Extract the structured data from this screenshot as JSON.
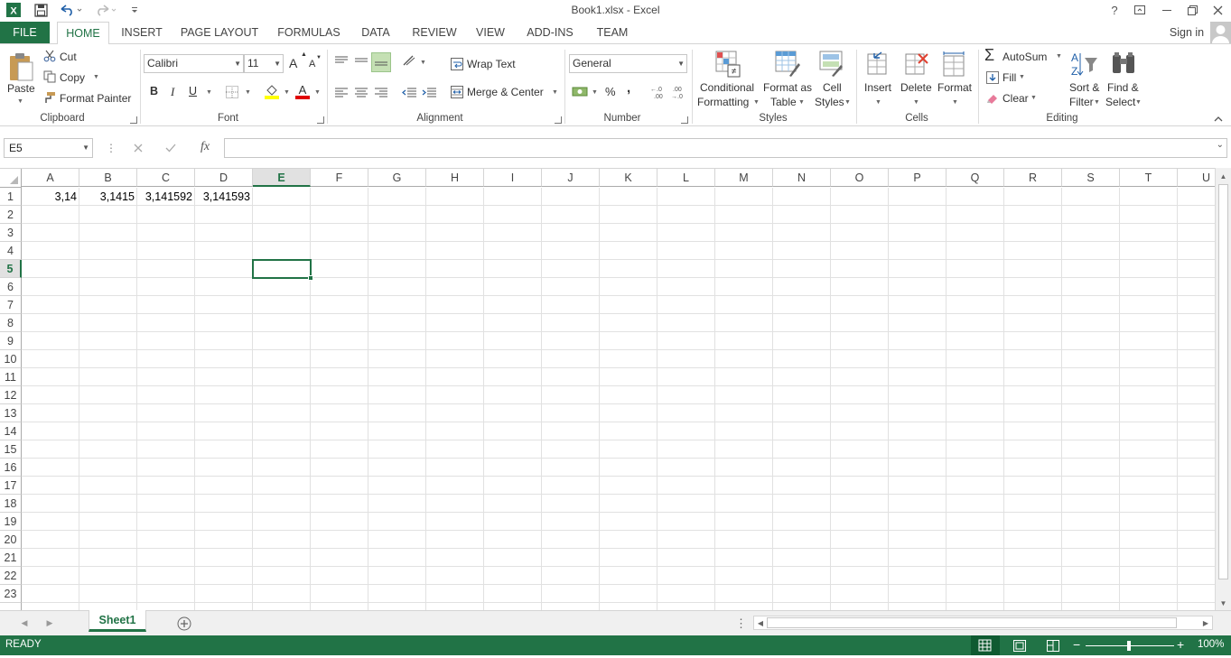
{
  "window": {
    "title": "Book1.xlsx - Excel",
    "sign_in": "Sign in",
    "help": "?"
  },
  "tabs": [
    "FILE",
    "HOME",
    "INSERT",
    "PAGE LAYOUT",
    "FORMULAS",
    "DATA",
    "REVIEW",
    "VIEW",
    "ADD-INS",
    "TEAM"
  ],
  "clipboard": {
    "paste": "Paste",
    "cut": "Cut",
    "copy": "Copy",
    "format_painter": "Format Painter",
    "label": "Clipboard"
  },
  "font": {
    "name": "Calibri",
    "size": "11",
    "bold": "B",
    "italic": "I",
    "underline": "U",
    "grow": "A",
    "shrink": "A",
    "label": "Font"
  },
  "alignment": {
    "wrap": "Wrap Text",
    "merge": "Merge & Center",
    "label": "Alignment"
  },
  "number": {
    "format": "General",
    "percent": "%",
    "comma": ",",
    "label": "Number"
  },
  "styles": {
    "conditional_1": "Conditional",
    "conditional_2": "Formatting",
    "format_table_1": "Format as",
    "format_table_2": "Table",
    "cell_styles_1": "Cell",
    "cell_styles_2": "Styles",
    "label": "Styles"
  },
  "cells": {
    "insert": "Insert",
    "delete": "Delete",
    "format": "Format",
    "label": "Cells"
  },
  "editing": {
    "autosum": "AutoSum",
    "fill": "Fill",
    "clear": "Clear",
    "sort_1": "Sort &",
    "sort_2": "Filter",
    "find_1": "Find &",
    "find_2": "Select",
    "label": "Editing"
  },
  "formula_bar": {
    "name_box": "E5",
    "fx": "fx",
    "formula": ""
  },
  "sheet": {
    "columns": [
      "A",
      "B",
      "C",
      "D",
      "E",
      "F",
      "G",
      "H",
      "I",
      "J",
      "K",
      "L",
      "M",
      "N",
      "O",
      "P",
      "Q",
      "R",
      "S",
      "T",
      "U"
    ],
    "rows": [
      "1",
      "2",
      "3",
      "4",
      "5",
      "6",
      "7",
      "8",
      "9",
      "10",
      "11",
      "12",
      "13",
      "14",
      "15",
      "16",
      "17",
      "18",
      "19",
      "20",
      "21",
      "22",
      "23"
    ],
    "selected_col": "E",
    "selected_row": "5",
    "cells": [
      {
        "ref": "A1",
        "value": "3,14"
      },
      {
        "ref": "B1",
        "value": "3,1415"
      },
      {
        "ref": "C1",
        "value": "3,141592"
      },
      {
        "ref": "D1",
        "value": "3,141593"
      }
    ]
  },
  "sheet_tabs": [
    "Sheet1"
  ],
  "status": {
    "mode": "READY",
    "zoom": "100%"
  },
  "colors": {
    "accent": "#217346"
  }
}
